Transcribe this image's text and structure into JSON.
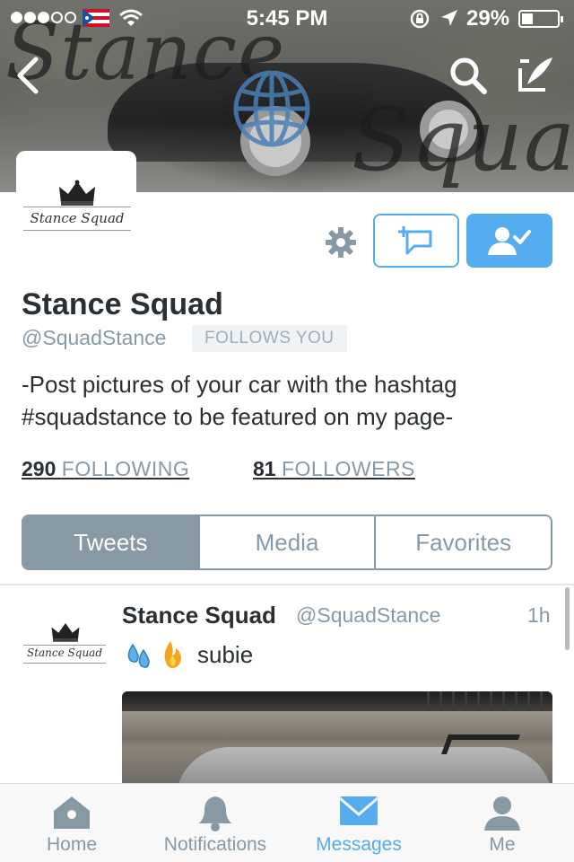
{
  "status_bar": {
    "time": "5:45 PM",
    "battery_percent": "29%",
    "signal_dots_filled": 3,
    "signal_dots_total": 5,
    "battery_level": 0.29
  },
  "header": {
    "banner_text_1": "Stance",
    "banner_text_2": "Squad",
    "back_icon": "chevron-left-icon",
    "search_icon": "search-icon",
    "compose_icon": "compose-tweet-icon"
  },
  "profile": {
    "avatar_wordmark": "Stance Squad",
    "name": "Stance Squad",
    "handle": "@SquadStance",
    "follows_you": "FOLLOWS YOU",
    "bio": "-Post pictures of your car with the hashtag #squadstance to be featured on my page-",
    "following_count": "290",
    "following_label": "FOLLOWING",
    "followers_count": "81",
    "followers_label": "FOLLOWERS",
    "settings_icon": "gear-icon",
    "add_to_list_icon": "add-to-list-icon",
    "following_button_icon": "user-check-icon"
  },
  "segments": [
    "Tweets",
    "Media",
    "Favorites"
  ],
  "active_segment": "Tweets",
  "tweet": {
    "avatar_wordmark": "Stance Squad",
    "name": "Stance Squad",
    "handle": "@SquadStance",
    "time": "1h",
    "emoji": [
      "sweat-droplets-icon",
      "fire-icon"
    ],
    "text": "subie"
  },
  "tab_bar": {
    "items": [
      {
        "label": "Home",
        "icon": "home-icon"
      },
      {
        "label": "Notifications",
        "icon": "bell-icon"
      },
      {
        "label": "Messages",
        "icon": "envelope-icon"
      },
      {
        "label": "Me",
        "icon": "person-icon"
      }
    ],
    "active": "Messages"
  },
  "colors": {
    "accent": "#55acee",
    "secondary_text": "#8899a6",
    "primary_text": "#292f33",
    "segment_active": "#8899a6"
  }
}
